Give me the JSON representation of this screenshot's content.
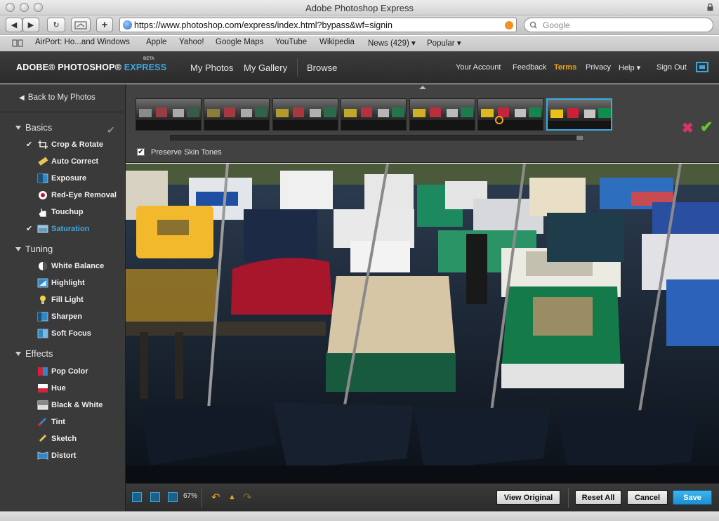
{
  "browser": {
    "window_title": "Adobe Photoshop Express",
    "url": "https://www.photoshop.com/express/index.html?bypass&wf=signin",
    "search_placeholder": "Google",
    "nav_buttons": [
      "◀",
      "▶",
      "↻",
      "+"
    ],
    "bookmarks": [
      "AirPort: Ho...and Windows",
      "Apple",
      "Yahoo!",
      "Google Maps",
      "YouTube",
      "Wikipedia",
      "News (429) ▾",
      "Popular ▾"
    ]
  },
  "header": {
    "logo": "ADOBE® PHOTOSHOP®",
    "logo_express": "EXPRESS",
    "logo_beta": "BETA",
    "nav": [
      "My Photos",
      "My Gallery",
      "Browse"
    ],
    "links": [
      "Your Account",
      "Feedback",
      "Terms",
      "Privacy",
      "Help ▾",
      "Sign Out"
    ],
    "active_link": "Terms",
    "accent_color": "#3aa9e0",
    "highlight_color": "#f2a51a"
  },
  "sidebar": {
    "back_label": "Back to My Photos",
    "sections": [
      {
        "title": "Basics",
        "tools": [
          {
            "label": "Crop & Rotate",
            "checked": true,
            "icon": "crop-icon"
          },
          {
            "label": "Auto Correct",
            "checked": false,
            "icon": "wand-icon"
          },
          {
            "label": "Exposure",
            "checked": false,
            "icon": "exposure-icon"
          },
          {
            "label": "Red-Eye Removal",
            "checked": false,
            "icon": "red-eye-icon"
          },
          {
            "label": "Touchup",
            "checked": false,
            "icon": "hand-icon"
          },
          {
            "label": "Saturation",
            "checked": true,
            "icon": "saturation-icon",
            "active": true
          }
        ]
      },
      {
        "title": "Tuning",
        "tools": [
          {
            "label": "White Balance",
            "checked": false,
            "icon": "white-balance-icon"
          },
          {
            "label": "Highlight",
            "checked": false,
            "icon": "highlight-icon"
          },
          {
            "label": "Fill Light",
            "checked": false,
            "icon": "bulb-icon"
          },
          {
            "label": "Sharpen",
            "checked": false,
            "icon": "sharpen-icon"
          },
          {
            "label": "Soft Focus",
            "checked": false,
            "icon": "soft-focus-icon"
          }
        ]
      },
      {
        "title": "Effects",
        "tools": [
          {
            "label": "Pop Color",
            "checked": false,
            "icon": "pop-color-icon"
          },
          {
            "label": "Hue",
            "checked": false,
            "icon": "hue-icon"
          },
          {
            "label": "Black & White",
            "checked": false,
            "icon": "black-white-icon"
          },
          {
            "label": "Tint",
            "checked": false,
            "icon": "tint-icon"
          },
          {
            "label": "Sketch",
            "checked": false,
            "icon": "sketch-icon"
          },
          {
            "label": "Distort",
            "checked": false,
            "icon": "distort-icon"
          }
        ]
      }
    ]
  },
  "filmstrip": {
    "thumbnail_count": 7,
    "selected_index": 6,
    "preserve_skin_tones_label": "Preserve Skin Tones",
    "preserve_skin_tones_checked": true
  },
  "bottombar": {
    "zoom_level": "67%",
    "buttons": {
      "view_original": "View Original",
      "reset_all": "Reset All",
      "cancel": "Cancel",
      "save": "Save"
    }
  }
}
